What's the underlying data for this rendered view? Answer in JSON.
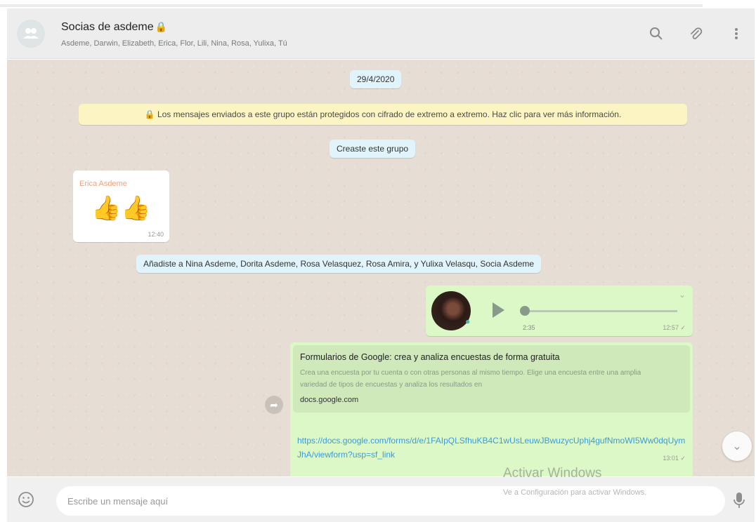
{
  "header": {
    "group_name": "Socias de asdeme",
    "group_emoji": "🔒",
    "members": "Asdeme, Darwin, Elizabeth, Erica, Flor, Lili, Nina, Rosa, Yulixa, Tú",
    "icons": [
      "search-icon",
      "attach-icon",
      "menu-icon"
    ]
  },
  "chat": {
    "date_chip": "29/4/2020",
    "encryption_notice": "🔒 Los mensajes enviados a este grupo están protegidos con cifrado de extremo a extremo. Haz clic para ver más información.",
    "created_notice": "Creaste este grupo",
    "message_1": {
      "sender": "Erica Asdeme",
      "text": "👍👍",
      "time": "12:40"
    },
    "added_notice": "Añadiste a Nina Asdeme, Dorita Asdeme, Rosa Velasquez, Rosa Amira, y Yulixa Velasqu, Socia Asdeme",
    "audio_message": {
      "duration": "2:35",
      "time": "12:57 ✓"
    },
    "link_message": {
      "preview_title": "Formularios de Google: crea y analiza encuestas de forma gratuita",
      "preview_description": "Crea una encuesta por tu cuenta o con otras personas al mismo tiempo. Elige una encuesta entre una amplia variedad de tipos de encuestas y analiza los resultados en",
      "preview_domain": "docs.google.com",
      "url": "https://docs.google.com/forms/d/e/1FAIpQLSfhuKB4C1wUsLeuwJBwuzycUphj4gufNmoWI5Ww0dqUymJhA/viewform?usp=sf_link",
      "time": "13:01 ✓"
    }
  },
  "watermark": {
    "line1": "Activar Windows",
    "line2": "Ve a Configuración para activar Windows."
  },
  "footer": {
    "placeholder": "Escribe un mensaje aquí"
  },
  "colors": {
    "header_bg": "#ededed",
    "chat_bg": "#e6ddd4",
    "outgoing_bubble": "#dcf8c6",
    "system_chip": "#e1f3fb",
    "notice_bg": "#fdf4c4",
    "link_color": "#3a9bd9"
  }
}
